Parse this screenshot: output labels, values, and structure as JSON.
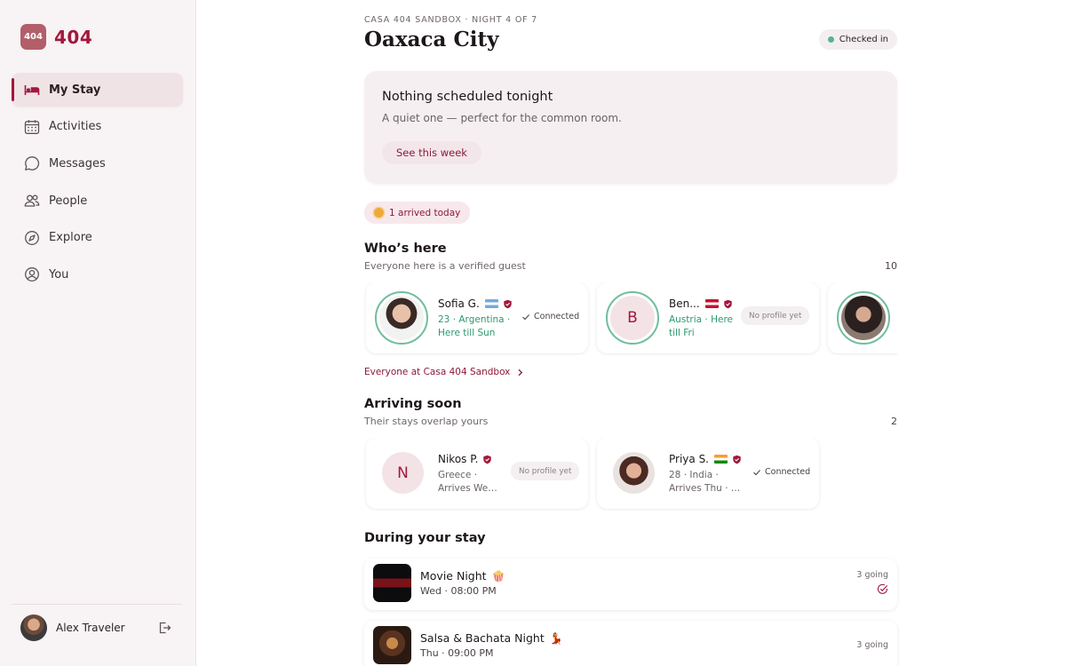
{
  "sidebar": {
    "logo_badge": "404",
    "logo_text": "404",
    "items": [
      {
        "label": "My Stay",
        "icon": "bed-icon",
        "active": true
      },
      {
        "label": "Activities",
        "icon": "calendar-icon"
      },
      {
        "label": "Messages",
        "icon": "message-bubble-icon"
      },
      {
        "label": "People",
        "icon": "people-icon"
      },
      {
        "label": "Explore",
        "icon": "compass-icon"
      },
      {
        "label": "You",
        "icon": "user-circle-icon"
      }
    ],
    "user": {
      "name": "Alex Traveler"
    }
  },
  "header": {
    "eyebrow": "CASA 404 SANDBOX · NIGHT 4 OF 7",
    "title": "Oaxaca City",
    "status": "Checked in"
  },
  "tonight": {
    "title": "Nothing scheduled tonight",
    "subtitle": "A quiet one — perfect for the common room.",
    "button": "See this week"
  },
  "arrived_badge": "1 arrived today",
  "whos_here": {
    "title": "Who’s here",
    "subtitle": "Everyone here is a verified guest",
    "count": "10",
    "guests": [
      {
        "name": "Sofia G.",
        "flag": "argentina",
        "meta_line1": "23 · Argentina ·",
        "meta_line2": "Here till Sun",
        "status": "Connected"
      },
      {
        "name": "Ben...",
        "flag": "austria",
        "initial": "B",
        "meta_line1": "Austria · Here",
        "meta_line2": "till Fri",
        "status": "No profile yet"
      }
    ],
    "link": "Everyone at Casa 404 Sandbox"
  },
  "arriving_soon": {
    "title": "Arriving soon",
    "subtitle": "Their stays overlap yours",
    "count": "2",
    "guests": [
      {
        "name": "Nikos P.",
        "initial": "N",
        "meta_line1": "Greece ·",
        "meta_line2": "Arrives Wed...",
        "status": "No profile yet"
      },
      {
        "name": "Priya S.",
        "flag": "india",
        "meta_line1": "28 · India ·",
        "meta_line2": "Arrives Thu · 2...",
        "status": "Connected"
      }
    ]
  },
  "during_stay": {
    "title": "During your stay",
    "events": [
      {
        "title": "Movie Night",
        "emoji": "🍿",
        "time": "Wed · 08:00 PM",
        "going": "3 going",
        "checked": true
      },
      {
        "title": "Salsa & Bachata Night",
        "emoji": "💃",
        "time": "Thu · 09:00 PM",
        "going": "3 going",
        "checked": false
      }
    ]
  },
  "colors": {
    "accent": "#a3173d",
    "green": "#2a9a6d",
    "sidebar_bg": "#f8f3f4"
  }
}
